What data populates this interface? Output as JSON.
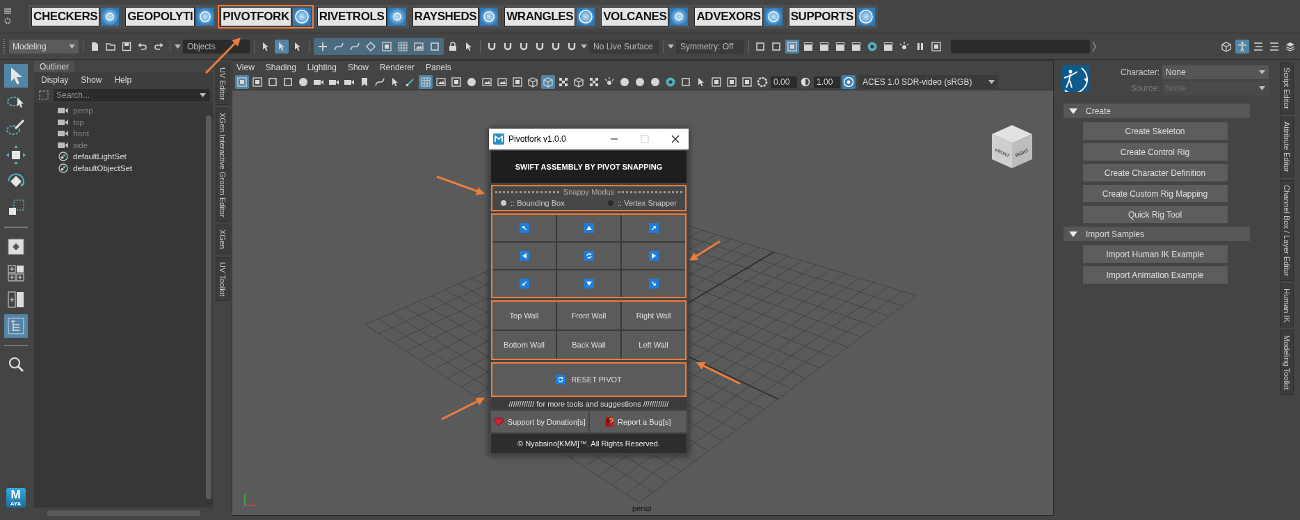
{
  "shelf": {
    "tabs": [
      {
        "label": "CHECKERS",
        "selected": false
      },
      {
        "label": "GEOPOLYTI",
        "selected": false
      },
      {
        "label": "PIVOTFORK",
        "selected": true
      },
      {
        "label": "RIVETROLS",
        "selected": false
      },
      {
        "label": "RAYSHEDS",
        "selected": false
      },
      {
        "label": "WRANGLES",
        "selected": false
      },
      {
        "label": "VOLCANES",
        "selected": false
      },
      {
        "label": "ADVEXORS",
        "selected": false
      },
      {
        "label": "SUPPORTS",
        "selected": false
      }
    ]
  },
  "status_line": {
    "mode": "Modeling",
    "selection_field": "Objects",
    "live_surface": "No Live Surface",
    "symmetry": "Symmetry: Off",
    "file_icons": [
      {
        "kind": "document",
        "selected": false
      },
      {
        "kind": "folder",
        "selected": false
      },
      {
        "kind": "disk",
        "selected": false
      },
      {
        "kind": "undo",
        "selected": false
      },
      {
        "kind": "redo",
        "selected": false
      }
    ],
    "select_icons": [
      {
        "kind": "cursor",
        "selected": false
      },
      {
        "kind": "cursor",
        "selected": true
      },
      {
        "kind": "cursor",
        "selected": false
      }
    ],
    "snap_icons": [
      {
        "kind": "plus",
        "selected": false
      },
      {
        "kind": "curve",
        "selected": false
      },
      {
        "kind": "curve",
        "selected": false
      },
      {
        "kind": "diamond",
        "selected": false
      },
      {
        "kind": "frame",
        "selected": false
      },
      {
        "kind": "grid",
        "selected": false
      },
      {
        "kind": "film",
        "selected": false
      },
      {
        "kind": "square",
        "selected": false
      }
    ],
    "lock_icons": [
      {
        "kind": "lock",
        "selected": false
      },
      {
        "kind": "cursor",
        "selected": false
      }
    ],
    "magnet_icons": [
      {
        "kind": "magnet",
        "selected": false
      },
      {
        "kind": "magnet",
        "selected": false
      },
      {
        "kind": "magnet",
        "selected": false
      },
      {
        "kind": "magnet",
        "selected": false
      },
      {
        "kind": "magnet",
        "selected": false
      },
      {
        "kind": "magnet",
        "selected": false
      }
    ],
    "render_icons": [
      {
        "kind": "square",
        "selected": false
      },
      {
        "kind": "square",
        "selected": false
      },
      {
        "kind": "frame",
        "selected": true
      },
      {
        "kind": "clapper",
        "selected": false
      },
      {
        "kind": "clapper",
        "selected": false
      },
      {
        "kind": "clapper",
        "selected": false
      },
      {
        "kind": "clapper",
        "selected": false
      },
      {
        "kind": "ring",
        "selected": false
      },
      {
        "kind": "clapper",
        "selected": false
      },
      {
        "kind": "light",
        "selected": false
      },
      {
        "kind": "pause",
        "selected": false
      },
      {
        "kind": "frame",
        "selected": false
      }
    ],
    "panel_icons": [
      {
        "kind": "cube",
        "selected": false
      },
      {
        "kind": "figure",
        "selected": true
      },
      {
        "kind": "list",
        "selected": false
      },
      {
        "kind": "list",
        "selected": false
      },
      {
        "kind": "layers",
        "selected": false
      }
    ]
  },
  "toolbox": {
    "tools": [
      {
        "kind": "select",
        "selected": true
      },
      {
        "kind": "lasso",
        "selected": false
      },
      {
        "kind": "paint",
        "selected": false
      },
      {
        "kind": "move",
        "selected": false
      },
      {
        "kind": "rotate",
        "selected": false
      },
      {
        "kind": "scale",
        "selected": false
      }
    ],
    "layouts": [
      {
        "kind": "single",
        "selected": false
      },
      {
        "kind": "four",
        "selected": false
      },
      {
        "kind": "two",
        "selected": false
      },
      {
        "kind": "outliner",
        "selected": true
      }
    ],
    "utilities": [
      {
        "kind": "search",
        "selected": false
      }
    ],
    "logo": {
      "letter": "M",
      "caption": "AYA"
    }
  },
  "outliner": {
    "tab": "Outliner",
    "menu": [
      "Display",
      "Show",
      "Help"
    ],
    "search": {
      "placeholder": "Search..."
    },
    "items": [
      {
        "label": "persp",
        "kind": "camera",
        "dimmed": true
      },
      {
        "label": "top",
        "kind": "camera",
        "dimmed": true
      },
      {
        "label": "front",
        "kind": "camera",
        "dimmed": true
      },
      {
        "label": "side",
        "kind": "camera",
        "dimmed": true
      },
      {
        "label": "defaultLightSet",
        "kind": "set",
        "dimmed": false
      },
      {
        "label": "defaultObjectSet",
        "kind": "set",
        "dimmed": false
      }
    ]
  },
  "left_tabs": [
    "UV Editor",
    "XGen Interactive Groom Editor",
    "XGen",
    "UV Toolkit"
  ],
  "viewport": {
    "menu": [
      "View",
      "Shading",
      "Lighting",
      "Show",
      "Renderer",
      "Panels"
    ],
    "icons": [
      {
        "kind": "frame",
        "selected": true
      },
      {
        "kind": "frame",
        "selected": false
      },
      {
        "kind": "square",
        "selected": false
      },
      {
        "kind": "square",
        "selected": false
      },
      {
        "kind": "sphere",
        "selected": false
      },
      {
        "kind": "camera",
        "selected": false
      },
      {
        "kind": "camera",
        "selected": false
      },
      {
        "kind": "camera",
        "selected": false
      },
      {
        "kind": "bookmark",
        "selected": false
      },
      {
        "kind": "curve",
        "selected": false
      },
      {
        "kind": "cursor",
        "selected": false
      },
      {
        "kind": "brush",
        "selected": false
      },
      {
        "kind": "grid",
        "selected": true
      },
      {
        "kind": "film",
        "selected": false
      },
      {
        "kind": "frame",
        "selected": false
      },
      {
        "kind": "sphere",
        "selected": false
      },
      {
        "kind": "film",
        "selected": false
      },
      {
        "kind": "film",
        "selected": false
      },
      {
        "kind": "frame",
        "selected": false
      },
      {
        "kind": "cube",
        "selected": false
      },
      {
        "kind": "cube",
        "selected": true
      },
      {
        "kind": "checker",
        "selected": false
      },
      {
        "kind": "cube",
        "selected": false
      },
      {
        "kind": "checker",
        "selected": false
      },
      {
        "kind": "light",
        "selected": false
      },
      {
        "kind": "sphere",
        "selected": false
      },
      {
        "kind": "sphere",
        "selected": false
      },
      {
        "kind": "sphere",
        "selected": false
      },
      {
        "kind": "ring",
        "selected": false
      },
      {
        "kind": "square",
        "selected": false
      },
      {
        "kind": "cursor",
        "selected": false
      },
      {
        "kind": "frame",
        "selected": false
      },
      {
        "kind": "frame",
        "selected": false
      },
      {
        "kind": "frame",
        "selected": false
      }
    ],
    "exposure": "0.00",
    "gamma": "1.00",
    "color_management_on": true,
    "color_space": "ACES 1.0 SDR-video (sRGB)",
    "view_cube": {
      "faces": [
        "FRONT",
        "RIGHT"
      ]
    },
    "camera_label": "persp"
  },
  "dialog": {
    "title": "Pivotfork v1.0.0",
    "header": "SWIFT ASSEMBLY BY PIVOT SNAPPING",
    "mode_title": "Snappy Modus",
    "modes": [
      {
        "label": ":: Bounding Box",
        "selected": true
      },
      {
        "label": ":: Vertex Snapper",
        "selected": false
      }
    ],
    "snap_buttons": [
      {
        "kind": "nw"
      },
      {
        "kind": "n"
      },
      {
        "kind": "ne"
      },
      {
        "kind": "w"
      },
      {
        "kind": "center"
      },
      {
        "kind": "e"
      },
      {
        "kind": "sw"
      },
      {
        "kind": "s"
      },
      {
        "kind": "se"
      }
    ],
    "walls": [
      "Top Wall",
      "Front Wall",
      "Right Wall",
      "Bottom Wall",
      "Back Wall",
      "Left Wall"
    ],
    "reset": "RESET PIVOT",
    "note": "//////////// for more tools and suggestions ////////////",
    "links": [
      {
        "label": "Support by Donation[s]",
        "kind": "heart"
      },
      {
        "label": "Report a Bug[s]",
        "kind": "bug"
      }
    ],
    "footer": "© Nyabsino[KMM]™. All Rights Reserved."
  },
  "right_panel": {
    "character_label": "Character:",
    "character": "None",
    "source_label": "Source:",
    "source": "None",
    "source_disabled": true,
    "sections": [
      {
        "title": "Create",
        "expanded": true,
        "buttons": [
          "Create Skeleton",
          "Create Control Rig",
          "Create Character Definition",
          "Create Custom Rig Mapping",
          "Quick Rig Tool"
        ]
      },
      {
        "title": "Import Samples",
        "expanded": true,
        "buttons": [
          "Import Human IK Example",
          "Import Animation Example"
        ]
      }
    ]
  },
  "right_tabs": [
    "Script Editor",
    "Attribute Editor",
    "Channel Box / Layer Editor",
    "Human IK",
    "Modeling Toolkit"
  ]
}
